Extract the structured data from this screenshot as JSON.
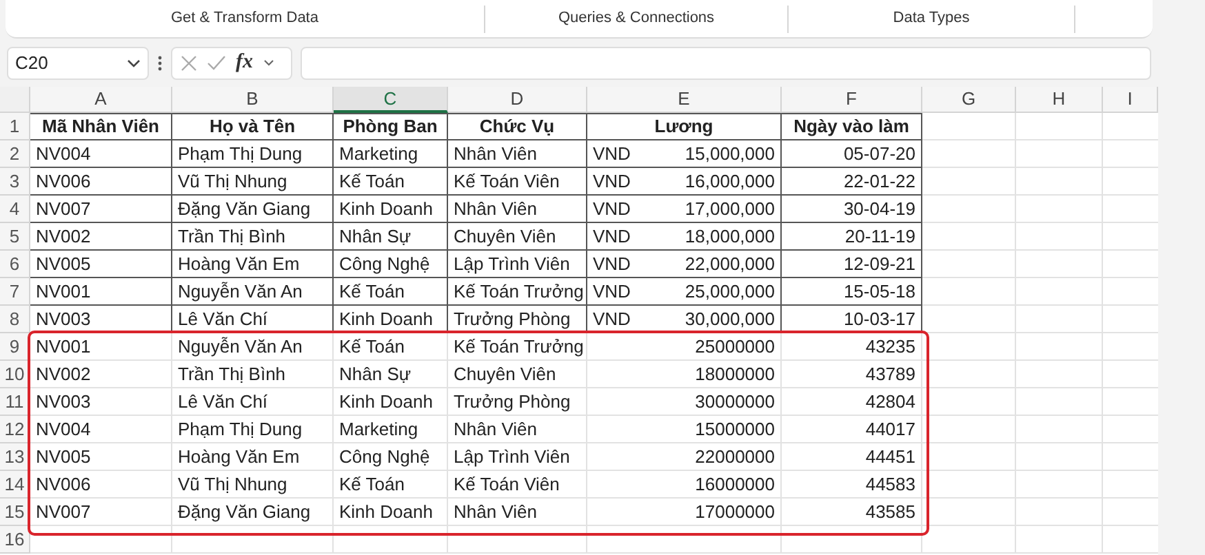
{
  "ribbon": {
    "groups": [
      "Get & Transform Data",
      "Queries & Connections",
      "Data Types"
    ]
  },
  "formula_bar": {
    "name_box": "C20",
    "fx": "fx"
  },
  "sheet": {
    "columns": [
      {
        "label": "A",
        "selected": false
      },
      {
        "label": "B",
        "selected": false
      },
      {
        "label": "C",
        "selected": true
      },
      {
        "label": "D",
        "selected": false
      },
      {
        "label": "E",
        "selected": false
      },
      {
        "label": "F",
        "selected": false
      },
      {
        "label": "G",
        "selected": false
      },
      {
        "label": "H",
        "selected": false
      },
      {
        "label": "I",
        "selected": false
      }
    ],
    "header_row": {
      "row": "1",
      "cells": [
        "Mã Nhân Viên",
        "Họ và Tên",
        "Phòng Ban",
        "Chức Vụ",
        "Lương",
        "Ngày vào làm"
      ]
    },
    "rows": [
      {
        "row": "2",
        "bordered": true,
        "id": "NV004",
        "name": "Phạm Thị Dung",
        "dept": "Marketing",
        "position": "Nhân Viên",
        "currency": "VND",
        "salary": "15,000,000",
        "date": "05-07-20"
      },
      {
        "row": "3",
        "bordered": true,
        "id": "NV006",
        "name": "Vũ Thị Nhung",
        "dept": "Kế Toán",
        "position": "Kế Toán Viên",
        "currency": "VND",
        "salary": "16,000,000",
        "date": "22-01-22"
      },
      {
        "row": "4",
        "bordered": true,
        "id": "NV007",
        "name": "Đặng Văn Giang",
        "dept": "Kinh Doanh",
        "position": "Nhân Viên",
        "currency": "VND",
        "salary": "17,000,000",
        "date": "30-04-19"
      },
      {
        "row": "5",
        "bordered": true,
        "id": "NV002",
        "name": "Trần Thị Bình",
        "dept": "Nhân Sự",
        "position": "Chuyên Viên",
        "currency": "VND",
        "salary": "18,000,000",
        "date": "20-11-19"
      },
      {
        "row": "6",
        "bordered": true,
        "id": "NV005",
        "name": "Hoàng Văn Em",
        "dept": "Công Nghệ",
        "position": "Lập Trình Viên",
        "currency": "VND",
        "salary": "22,000,000",
        "date": "12-09-21"
      },
      {
        "row": "7",
        "bordered": true,
        "id": "NV001",
        "name": "Nguyễn Văn An",
        "dept": "Kế Toán",
        "position": "Kế Toán Trưởng",
        "currency": "VND",
        "salary": "25,000,000",
        "date": "15-05-18"
      },
      {
        "row": "8",
        "bordered": true,
        "id": "NV003",
        "name": "Lê Văn Chí",
        "dept": "Kinh Doanh",
        "position": "Trưởng Phòng",
        "currency": "VND",
        "salary": "30,000,000",
        "date": "10-03-17"
      },
      {
        "row": "9",
        "bordered": false,
        "id": "NV001",
        "name": "Nguyễn Văn An",
        "dept": "Kế Toán",
        "position": "Kế Toán Trưởng",
        "salary": "25000000",
        "date": "43235"
      },
      {
        "row": "10",
        "bordered": false,
        "id": "NV002",
        "name": "Trần Thị Bình",
        "dept": "Nhân Sự",
        "position": "Chuyên Viên",
        "salary": "18000000",
        "date": "43789"
      },
      {
        "row": "11",
        "bordered": false,
        "id": "NV003",
        "name": "Lê Văn Chí",
        "dept": "Kinh Doanh",
        "position": "Trưởng Phòng",
        "salary": "30000000",
        "date": "42804"
      },
      {
        "row": "12",
        "bordered": false,
        "id": "NV004",
        "name": "Phạm Thị Dung",
        "dept": "Marketing",
        "position": "Nhân Viên",
        "salary": "15000000",
        "date": "44017"
      },
      {
        "row": "13",
        "bordered": false,
        "id": "NV005",
        "name": "Hoàng Văn Em",
        "dept": "Công Nghệ",
        "position": "Lập Trình Viên",
        "salary": "22000000",
        "date": "44451"
      },
      {
        "row": "14",
        "bordered": false,
        "id": "NV006",
        "name": "Vũ Thị Nhung",
        "dept": "Kế Toán",
        "position": "Kế Toán Viên",
        "salary": "16000000",
        "date": "44583"
      },
      {
        "row": "15",
        "bordered": false,
        "id": "NV007",
        "name": "Đặng Văn Giang",
        "dept": "Kinh Doanh",
        "position": "Nhân Viên",
        "salary": "17000000",
        "date": "43585"
      },
      {
        "row": "16"
      }
    ]
  }
}
